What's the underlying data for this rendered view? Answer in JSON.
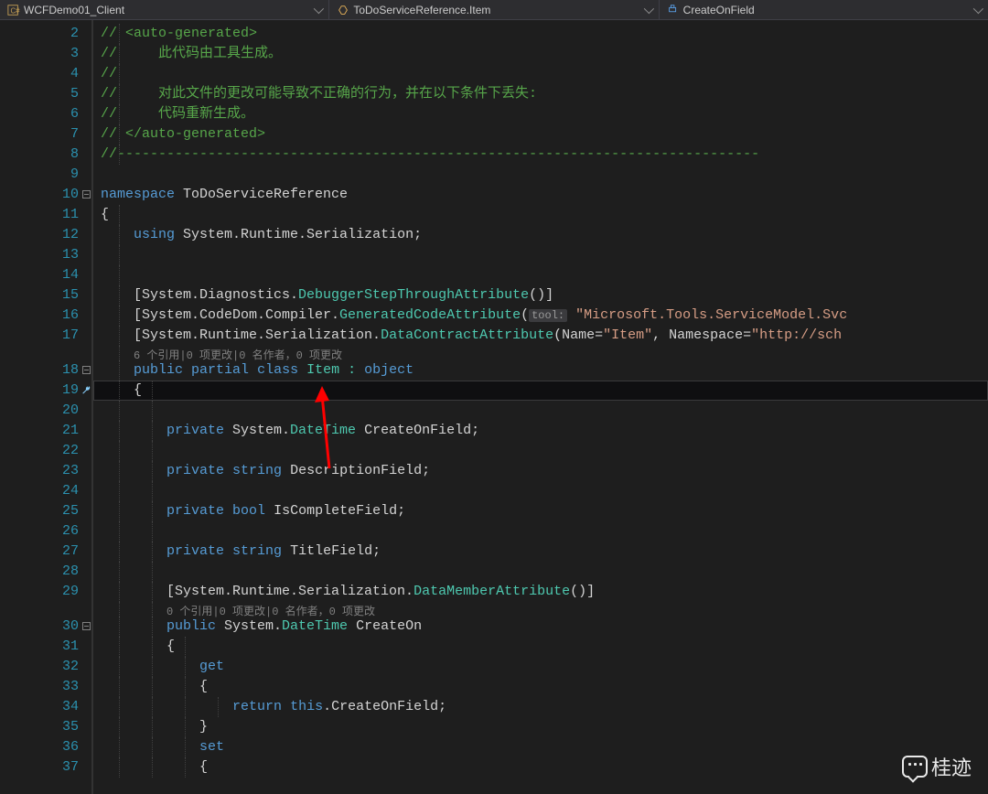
{
  "navbar": {
    "project": "WCFDemo01_Client",
    "type": "ToDoServiceReference.Item",
    "member": "CreateOnField"
  },
  "editor": {
    "codelens1": "6 个引用|0 项更改|0 名作者，0 项更改",
    "codelens2": "0 个引用|0 项更改|0 名作者，0 项更改",
    "lines": {
      "l2": "// <auto-generated>",
      "l3": "//     此代码由工具生成。",
      "l4": "//",
      "l5": "//     对此文件的更改可能导致不正确的行为，并在以下条件下丢失:",
      "l6": "//     代码重新生成。",
      "l7": "// </auto-generated>",
      "l8": "//------------------------------------------------------------------------------",
      "l10_kw_ns": "namespace",
      "l10_ns": " ToDoServiceReference",
      "l11": "{",
      "l12_kw": "using",
      "l12_rest": " System.Runtime.Serialization;",
      "l15_a": "    [System.Diagnostics.",
      "l15_b": "DebuggerStepThroughAttribute",
      "l15_c": "()]",
      "l16_a": "    [System.CodeDom.Compiler.",
      "l16_b": "GeneratedCodeAttribute",
      "l16_hint": "tool:",
      "l16_c": "(",
      "l16_str": "\"Microsoft.Tools.ServiceModel.Svc",
      "l17_a": "    [System.Runtime.Serialization.",
      "l17_b": "DataContractAttribute",
      "l17_c": "(Name=",
      "l17_s1": "\"Item\"",
      "l17_d": ", Namespace=",
      "l17_s2": "\"http://sch",
      "l18_a": "public",
      "l18_b": "partial",
      "l18_c": "class",
      "l18_d": " Item : ",
      "l18_e": "object",
      "l19": "    {",
      "l21_a": "private",
      "l21_b": " System.",
      "l21_c": "DateTime",
      "l21_d": " CreateOnField;",
      "l23_a": "private",
      "l23_b": "string",
      "l23_c": " DescriptionField;",
      "l25_a": "private",
      "l25_b": "bool",
      "l25_c": " IsCompleteField;",
      "l27_a": "private",
      "l27_b": "string",
      "l27_c": " TitleField;",
      "l29_a": "        [System.Runtime.Serialization.",
      "l29_b": "DataMemberAttribute",
      "l29_c": "()]",
      "l30_a": "public",
      "l30_b": " System.",
      "l30_c": "DateTime",
      "l30_d": " CreateOn",
      "l31": "        {",
      "l32": "get",
      "l33": "            {",
      "l34_a": "return",
      "l34_b": "this",
      "l34_c": ".CreateOnField;",
      "l35": "            }",
      "l36": "set",
      "l37": "            {"
    }
  },
  "watermark": {
    "text": "桂迹"
  }
}
